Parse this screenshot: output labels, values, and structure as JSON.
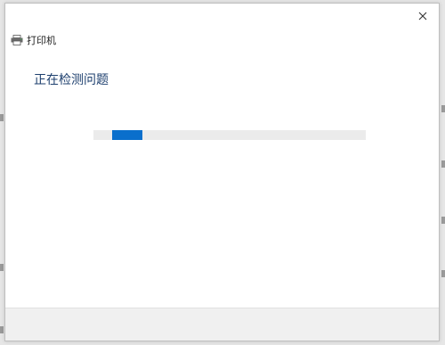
{
  "window": {
    "title": "打印机",
    "close_glyph": "✕"
  },
  "main": {
    "heading": "正在检测问题"
  },
  "progress": {
    "indeterminate": true,
    "segment_start_fraction": 0.07,
    "segment_length_fraction": 0.11
  },
  "icons": {
    "title_icon": "printer-icon",
    "close_icon": "close-icon"
  },
  "colors": {
    "accent": "#0a6fcc",
    "heading": "#1d3f6e",
    "track": "#ebebeb",
    "footer": "#f0f0f0"
  }
}
